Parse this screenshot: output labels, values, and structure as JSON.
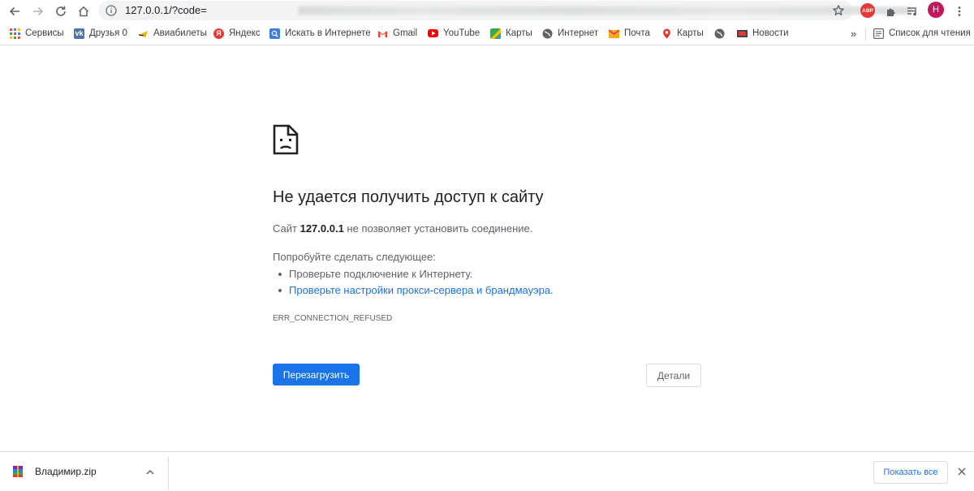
{
  "browser": {
    "url": "127.0.0.1/?code=",
    "icons": [
      "back-icon",
      "forward-icon",
      "reload-icon",
      "home-icon",
      "info-icon",
      "bookmark-star-icon",
      "extensions-icon",
      "media-control-icon"
    ],
    "extension_abp_label": "ABP",
    "profile_initial": "Н"
  },
  "bookmarks": {
    "items": [
      {
        "label": "Сервисы",
        "icon": "apps-grid-icon"
      },
      {
        "label": "Друзья 0",
        "icon": "vk-icon",
        "color": "#4a76a8"
      },
      {
        "label": "Авиабилеты",
        "icon": "plane-icon"
      },
      {
        "label": "Яндекс",
        "icon": "yandex-icon",
        "color": "#e53935"
      },
      {
        "label": "Искать в Интернете",
        "icon": "search-icon",
        "color": "#3d7fe0"
      },
      {
        "label": "Gmail",
        "icon": "gmail-icon"
      },
      {
        "label": "YouTube",
        "icon": "youtube-icon",
        "color": "#ff0000"
      },
      {
        "label": "Карты",
        "icon": "google-maps-icon"
      },
      {
        "label": "Интернет",
        "icon": "globe-icon"
      },
      {
        "label": "Почта",
        "icon": "mail-icon",
        "color": "#f5a623"
      },
      {
        "label": "Карты",
        "icon": "map-pin-icon",
        "color": "#e53935"
      },
      {
        "label": "",
        "icon": "globe-icon"
      },
      {
        "label": "Новости",
        "icon": "news-icon"
      }
    ],
    "overflow": "»",
    "reading_list": "Список для чтения"
  },
  "error": {
    "title": "Не удается получить доступ к сайту",
    "desc_prefix": "Сайт ",
    "host": "127.0.0.1",
    "desc_suffix": " не позволяет установить соединение.",
    "try_title": "Попробуйте сделать следующее:",
    "suggestions": [
      "Проверьте подключение к Интернету.",
      "Проверьте настройки прокси-сервера и брандмауэра"
    ],
    "suggestion_period": ".",
    "code": "ERR_CONNECTION_REFUSED",
    "reload_button": "Перезагрузить",
    "details_button": "Детали"
  },
  "downloads": {
    "file_name": "Владимир.zip",
    "show_all": "Показать все"
  },
  "colors": {
    "accent": "#1a73e8",
    "text_secondary": "#5f6368",
    "avatar": "#c2185b"
  }
}
